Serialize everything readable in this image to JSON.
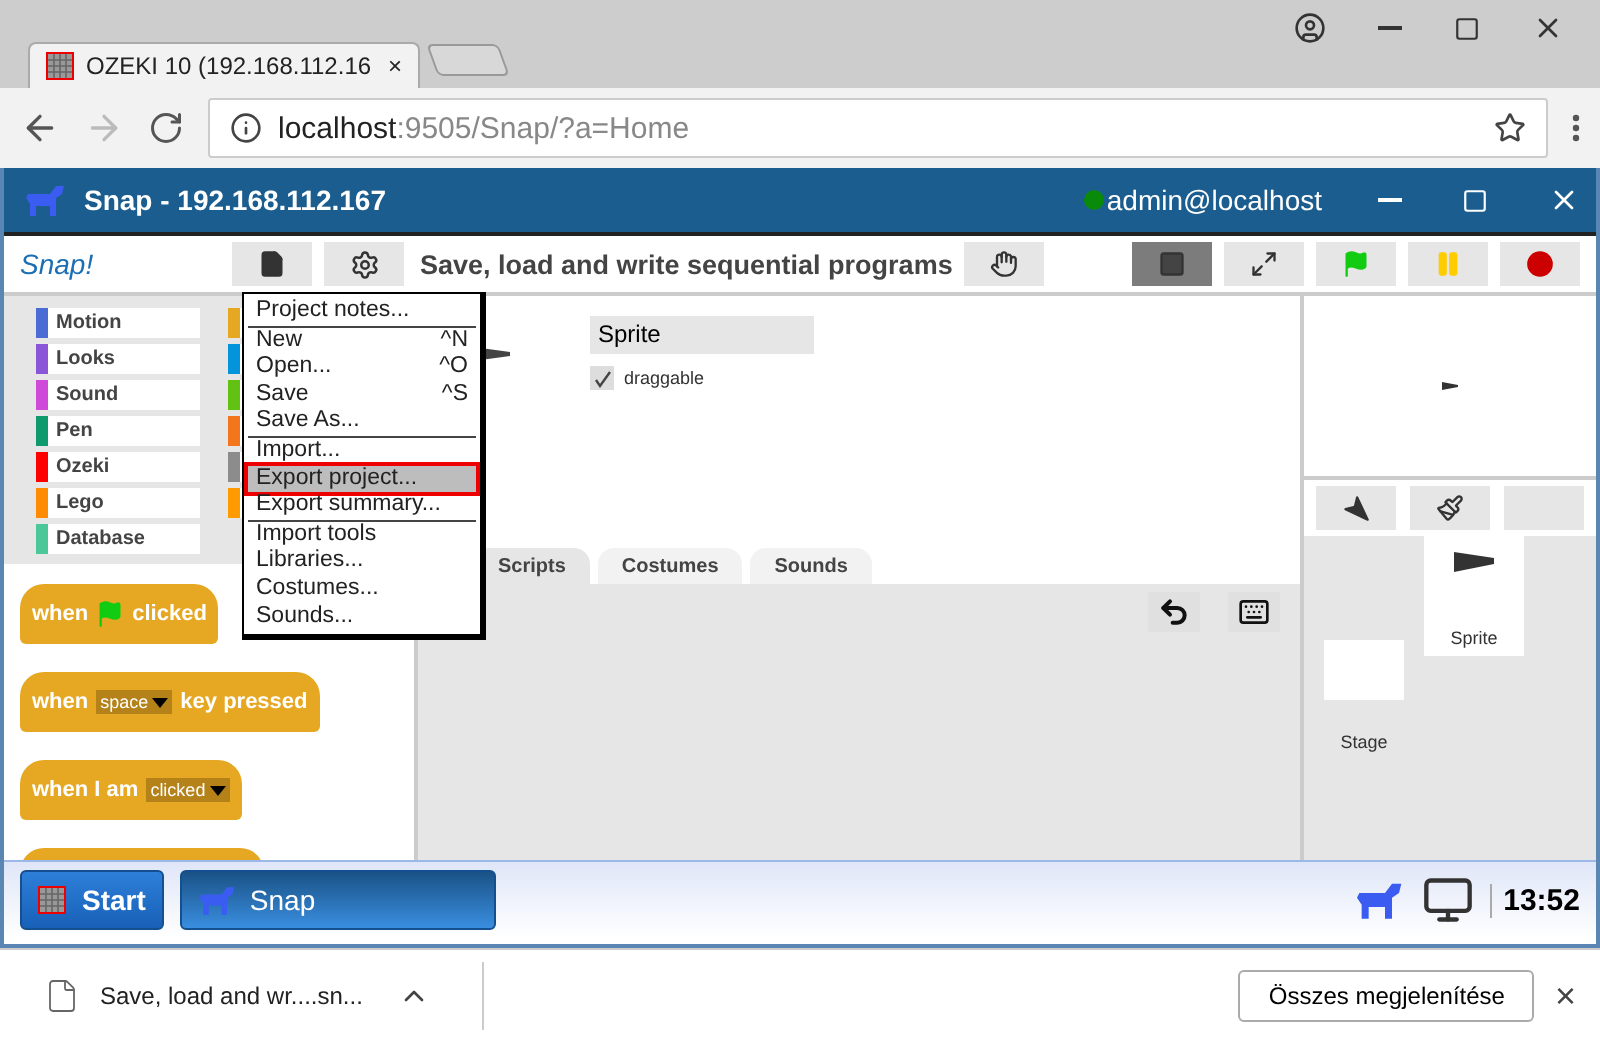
{
  "browser": {
    "tab": {
      "title": "OZEKI 10 (192.168.112.16",
      "close": "×"
    },
    "url": {
      "host": "localhost",
      "path": ":9505/Snap/?a=Home"
    }
  },
  "window": {
    "title": "Snap - 192.168.112.167",
    "user": "admin@localhost",
    "online": true
  },
  "snap": {
    "logo": "Snap!",
    "project_title": "Save, load and write sequential programs",
    "categories": [
      {
        "label": "Motion",
        "color": "#4a6cd4"
      },
      {
        "label": "Looks",
        "color": "#8a55d7"
      },
      {
        "label": "Sound",
        "color": "#cf4ad9"
      },
      {
        "label": "Pen",
        "color": "#0e9a6c"
      },
      {
        "label": "Ozeki",
        "color": "#ff0000"
      },
      {
        "label": "Lego",
        "color": "#ff8c00"
      },
      {
        "label": "Database",
        "color": "#4cc79a"
      }
    ],
    "categories_covered": [
      {
        "color": "#e6a822"
      },
      {
        "color": "#0494dc"
      },
      {
        "color": "#62c213"
      },
      {
        "color": "#f3761d"
      },
      {
        "color": "#8c8c8c"
      },
      {
        "color": "#ff9a00"
      }
    ],
    "blocks": [
      {
        "kind": "hat",
        "parts": [
          {
            "kind": "text",
            "text": "when"
          },
          {
            "kind": "flag"
          },
          {
            "kind": "text",
            "text": "clicked"
          }
        ]
      },
      {
        "kind": "hat",
        "parts": [
          {
            "kind": "text",
            "text": "when"
          },
          {
            "kind": "dropdown",
            "text": "space"
          },
          {
            "kind": "text",
            "text": "key pressed"
          }
        ]
      },
      {
        "kind": "hat",
        "parts": [
          {
            "kind": "text",
            "text": "when I am"
          },
          {
            "kind": "dropdown",
            "text": "clicked"
          }
        ]
      },
      {
        "kind": "partial"
      }
    ],
    "sprite": {
      "name": "Sprite",
      "draggable_label": "draggable",
      "draggable": true
    },
    "tabs": [
      {
        "label": "Scripts",
        "selected": true
      },
      {
        "label": "Costumes",
        "selected": false
      },
      {
        "label": "Sounds",
        "selected": false
      }
    ],
    "corral": {
      "sprite": "Sprite",
      "stage": "Stage"
    },
    "menu": {
      "items": [
        {
          "label": "Project notes...",
          "separator_before": false,
          "selected": false
        },
        {
          "label": "New",
          "shortcut": "^N",
          "separator_before": true,
          "selected": false
        },
        {
          "label": "Open...",
          "shortcut": "^O",
          "separator_before": false,
          "selected": false
        },
        {
          "label": "Save",
          "shortcut": "^S",
          "separator_before": false,
          "selected": false
        },
        {
          "label": "Save As...",
          "separator_before": false,
          "selected": false
        },
        {
          "label": "Import...",
          "separator_before": true,
          "selected": false
        },
        {
          "label": "Export project...",
          "separator_before": false,
          "selected": true
        },
        {
          "label": "Export summary...",
          "separator_before": false,
          "selected": false
        },
        {
          "label": "Import tools",
          "separator_before": true,
          "selected": false
        },
        {
          "label": "Libraries...",
          "separator_before": false,
          "selected": false
        },
        {
          "label": "Costumes...",
          "separator_before": false,
          "selected": false
        },
        {
          "label": "Sounds...",
          "separator_before": false,
          "selected": false
        }
      ]
    }
  },
  "taskbar": {
    "start": "Start",
    "apps": [
      {
        "label": "Snap"
      }
    ],
    "clock": "13:52"
  },
  "downloads": {
    "file": "Save, load and wr....sn...",
    "show_all": "Összes megjelenítése",
    "close": "×"
  }
}
